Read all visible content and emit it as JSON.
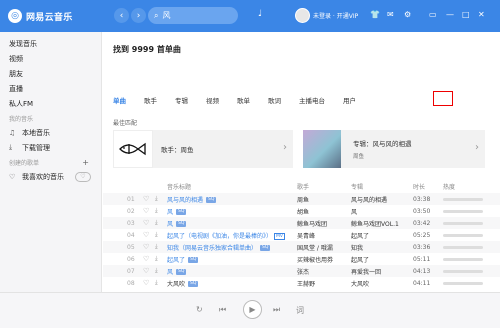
{
  "app": {
    "logo_glyph": "◎",
    "title": "网易云音乐",
    "accent": "#3b86e6"
  },
  "search": {
    "value": "风"
  },
  "user": {
    "name": "未登录 · 开通VIP"
  },
  "sidebar": {
    "items_top": [
      {
        "label": "发现音乐"
      },
      {
        "label": "视频"
      },
      {
        "label": "朋友"
      },
      {
        "label": "直播"
      },
      {
        "label": "私人FM"
      }
    ],
    "my_music_header": "我的音乐",
    "my_music": [
      {
        "label": "本地音乐",
        "icon": "♫"
      },
      {
        "label": "下载管理",
        "icon": "⤓"
      }
    ],
    "created_header": "创建的歌单",
    "created": [
      {
        "label": "我喜欢的音乐",
        "icon": "♡"
      }
    ]
  },
  "main": {
    "found_text": "找到 9999 首单曲",
    "tabs": [
      "单曲",
      "歌手",
      "专辑",
      "视频",
      "歌单",
      "歌词",
      "主播电台",
      "用户"
    ],
    "best_label": "最佳匹配",
    "best_artist": "歌手：周鱼",
    "best_album_title": "专辑：风与风的相遇",
    "best_album_artist": "周鱼"
  },
  "table": {
    "headers": {
      "title": "音乐标题",
      "artist": "歌手",
      "album": "专辑",
      "time": "时长",
      "heat": "热度"
    },
    "rows": [
      {
        "num": "01",
        "title": "风与风的相遇",
        "badge": "SQ",
        "mv": "",
        "artist": "周鱼",
        "album": "风与风的相遇",
        "time": "03:38"
      },
      {
        "num": "02",
        "title": "风",
        "badge": "SQ",
        "mv": "",
        "artist": "胡鱼",
        "album": "风",
        "time": "03:50"
      },
      {
        "num": "03",
        "title": "风",
        "badge": "SQ",
        "mv": "",
        "artist": "鲸鱼马戏团",
        "album": "鲸鱼马戏团VOL.1",
        "time": "03:42"
      },
      {
        "num": "04",
        "title": "起风了（电视剧《加油，你是最棒的》）",
        "badge": "SQ",
        "mv": "MV",
        "artist": "吴青峰",
        "album": "起风了",
        "time": "05:25"
      },
      {
        "num": "05",
        "title": "知我（网易云音乐独家合辑单曲）",
        "badge": "SQ",
        "mv": "",
        "artist": "国风堂 / 哦漏",
        "album": "知我",
        "time": "03:36"
      },
      {
        "num": "06",
        "title": "起风了",
        "badge": "SQ",
        "mv": "",
        "artist": "买辣椒也用券",
        "album": "起风了",
        "time": "05:11"
      },
      {
        "num": "07",
        "title": "风",
        "badge": "SQ",
        "mv": "",
        "artist": "张杰",
        "album": "再爱我一回",
        "time": "04:13"
      },
      {
        "num": "08",
        "title": "大风吹",
        "badge": "SQ",
        "mv": "",
        "artist": "王赫野",
        "album": "大风吹",
        "time": "04:11"
      }
    ]
  },
  "player": {
    "loop_icon": "↻",
    "prev_icon": "⏮",
    "play_icon": "▶",
    "next_icon": "⏭",
    "lyric_icon": "词"
  }
}
